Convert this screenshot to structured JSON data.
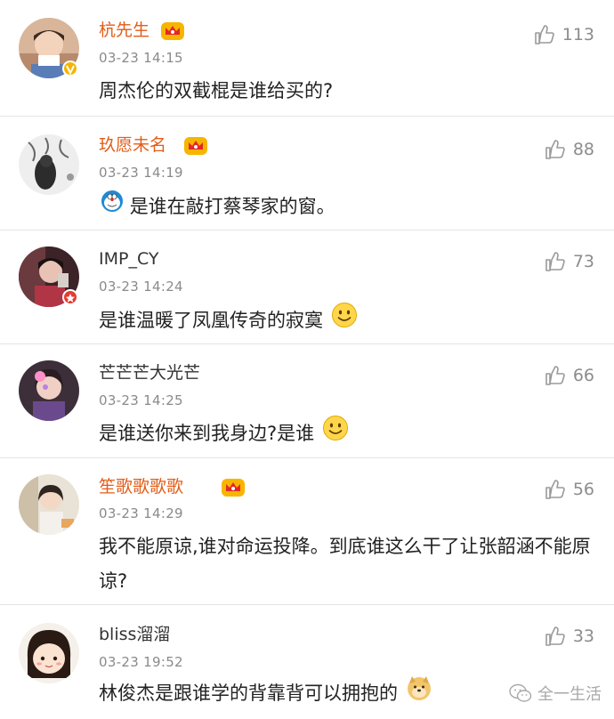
{
  "comments": [
    {
      "username": "杭先生",
      "timestamp": "03-23 14:15",
      "text": "周杰伦的双截棍是谁给买的?",
      "likes": "113",
      "vip": true,
      "badge": "yellow-verified-badge"
    },
    {
      "username": "玖愿未名",
      "timestamp": "03-23 14:19",
      "text": "是谁在敲打蔡琴家的窗。",
      "likes": "88",
      "vip": true,
      "leading_emoji": "doraemon-emoji"
    },
    {
      "username": "IMP_CY",
      "timestamp": "03-23 14:24",
      "text": "是谁温暖了凤凰传奇的寂寞",
      "likes": "73",
      "vip": false,
      "badge": "red-star-badge",
      "trailing_emoji": "smile-emoji"
    },
    {
      "username": "芒芒芒大光芒",
      "timestamp": "03-23 14:25",
      "text": "是谁送你来到我身边?是谁",
      "likes": "66",
      "vip": false,
      "trailing_emoji": "smile-emoji"
    },
    {
      "username": "笙歌歌歌歌",
      "timestamp": "03-23 14:29",
      "text": "我不能原谅,谁对命运投降。到底谁这么干了让张韶涵不能原谅?",
      "likes": "56",
      "vip": true
    },
    {
      "username": "bliss溜溜",
      "timestamp": "03-23 19:52",
      "text": "林俊杰是跟谁学的背靠背可以拥抱的",
      "likes": "33",
      "vip": false,
      "trailing_emoji": "doge-emoji"
    }
  ],
  "watermark": {
    "text": "全一生活",
    "icon": "wechat-icon"
  },
  "colors": {
    "vip_name": "#e35c17",
    "timestamp": "#8a8a8a",
    "divider": "#e4e4e4"
  }
}
